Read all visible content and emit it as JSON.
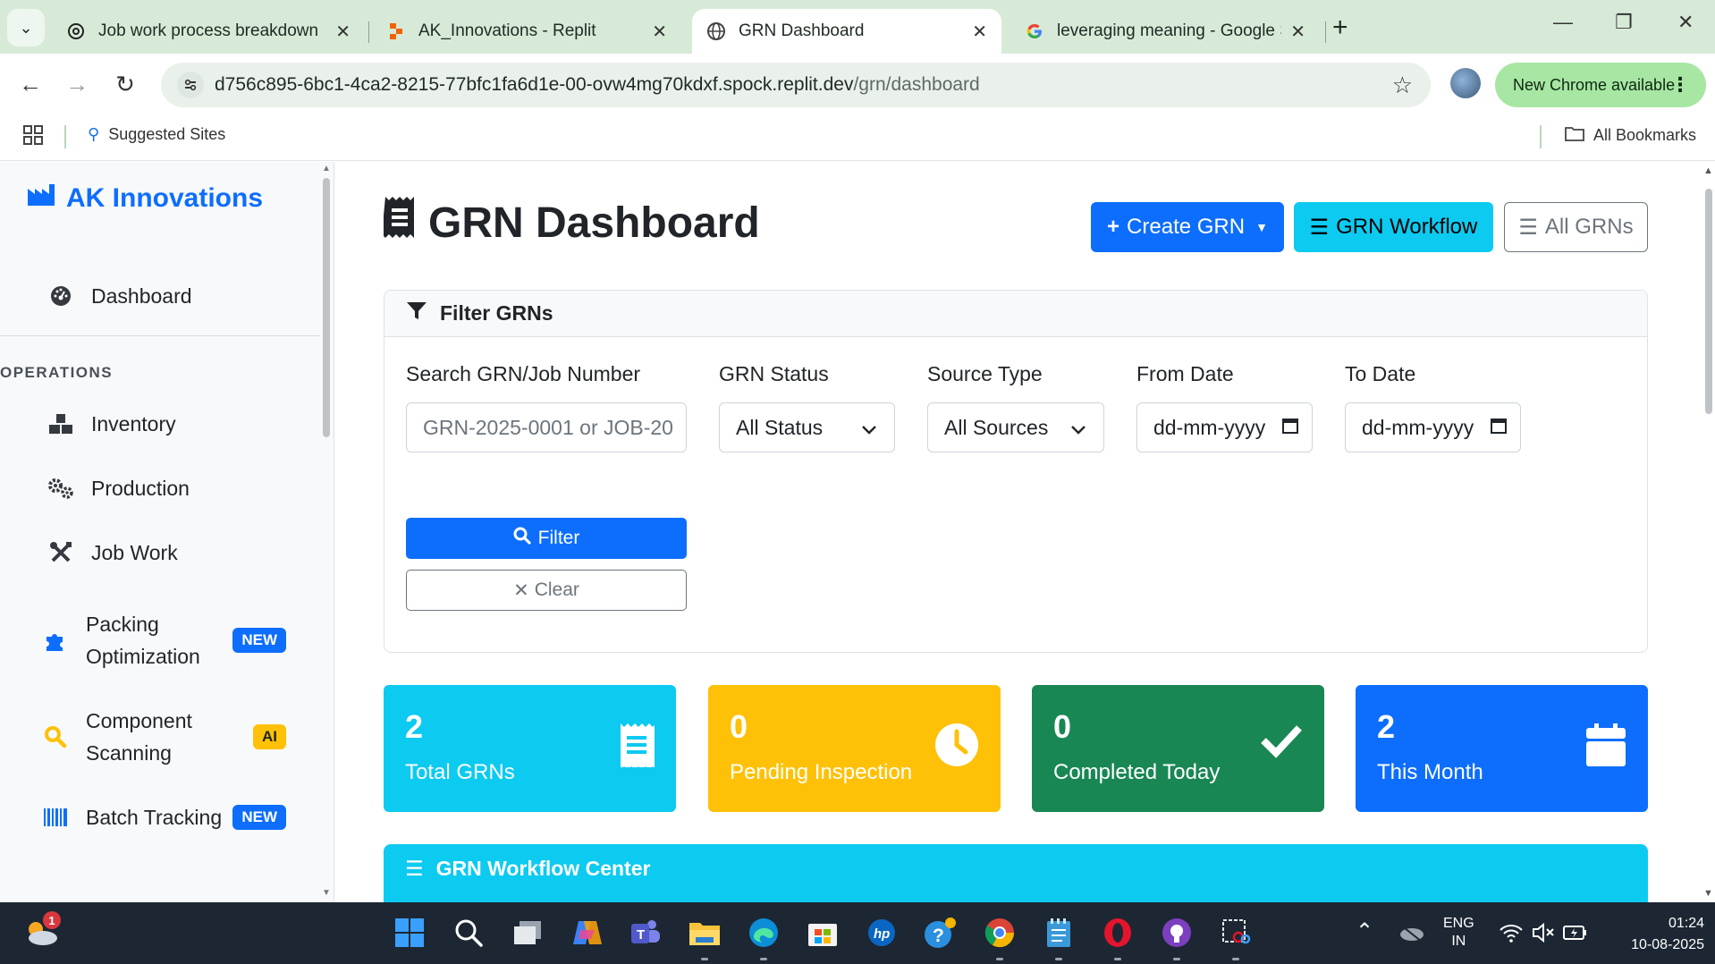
{
  "browser": {
    "tabs": [
      {
        "title": "Job work process breakdown",
        "active": false
      },
      {
        "title": "AK_Innovations - Replit",
        "active": false
      },
      {
        "title": "GRN Dashboard",
        "active": true
      },
      {
        "title": "leveraging meaning - Google S",
        "active": false
      }
    ],
    "url_host": "d756c895-6bc1-4ca2-8215-77bfc1fa6d1e-00-ovw4mg70kdxf.spock.replit.dev",
    "url_path": "/grn/dashboard",
    "update_label": "New Chrome available",
    "bookmarks": {
      "suggested": "Suggested Sites",
      "all": "All Bookmarks"
    }
  },
  "sidebar": {
    "brand": "AK Innovations",
    "dashboard_label": "Dashboard",
    "section_heading": "OPERATIONS",
    "items": [
      {
        "label": "Inventory",
        "icon": "boxes-icon"
      },
      {
        "label": "Production",
        "icon": "gears-icon"
      },
      {
        "label": "Job Work",
        "icon": "tools-icon"
      },
      {
        "label": "Packing Optimization",
        "icon": "puzzle-icon",
        "badge": "NEW"
      },
      {
        "label": "Component Scanning",
        "icon": "search-icon",
        "badge": "AI"
      },
      {
        "label": "Batch Tracking",
        "icon": "barcode-icon",
        "badge": "NEW"
      }
    ]
  },
  "main": {
    "title": "GRN Dashboard",
    "buttons": {
      "create": "Create GRN",
      "workflow": "GRN Workflow",
      "all": "All GRNs"
    },
    "filter": {
      "header": "Filter GRNs",
      "search_label": "Search GRN/Job Number",
      "search_placeholder": "GRN-2025-0001 or JOB-20",
      "status_label": "GRN Status",
      "status_value": "All Status",
      "source_label": "Source Type",
      "source_value": "All Sources",
      "from_label": "From Date",
      "from_placeholder": "dd-mm-yyyy",
      "to_label": "To Date",
      "to_placeholder": "dd-mm-yyyy",
      "filter_btn": "Filter",
      "clear_btn": "Clear"
    },
    "stats": [
      {
        "value": "2",
        "label": "Total GRNs",
        "icon": "receipt-icon",
        "color": "#0dcaf0"
      },
      {
        "value": "0",
        "label": "Pending Inspection",
        "icon": "clock-icon",
        "color": "#ffc107"
      },
      {
        "value": "0",
        "label": "Completed Today",
        "icon": "check-icon",
        "color": "#198754"
      },
      {
        "value": "2",
        "label": "This Month",
        "icon": "calendar-icon",
        "color": "#0d6efd"
      }
    ],
    "workflow_center": "GRN Workflow Center"
  },
  "taskbar": {
    "weather_badge": "1",
    "lang_line1": "ENG",
    "lang_line2": "IN",
    "time": "01:24",
    "date": "10-08-2025"
  }
}
